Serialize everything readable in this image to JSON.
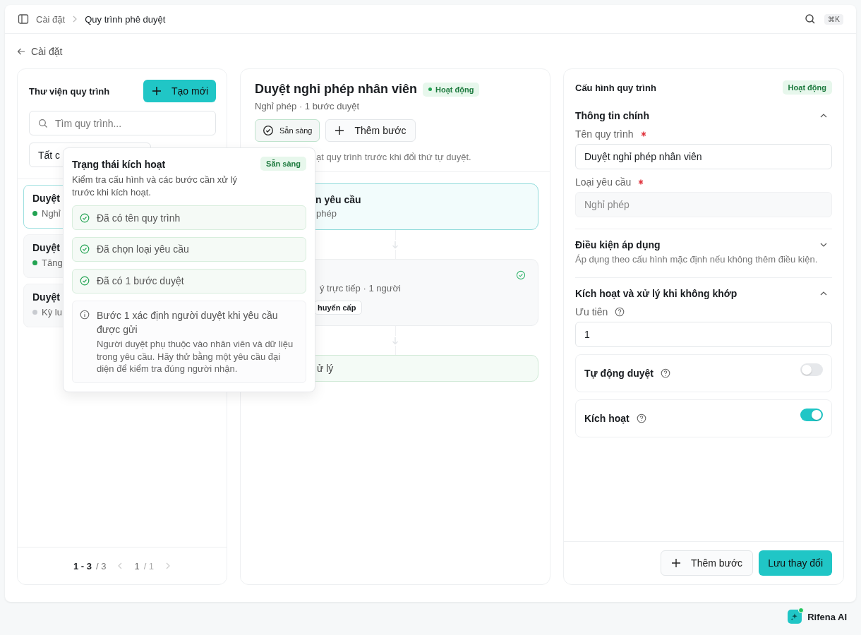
{
  "breadcrumb": {
    "items": [
      {
        "label": "Cài đặt",
        "current": false
      },
      {
        "label": "Quy trình phê duyệt",
        "current": true
      }
    ],
    "shortcut": "⌘K"
  },
  "back_link": "Cài đặt",
  "library": {
    "title": "Thư viện quy trình",
    "create_button": "Tạo mới",
    "search_placeholder": "Tìm quy trình...",
    "filter": "Tất c",
    "items": [
      {
        "title": "Duyệt",
        "subtitle": "Nghỉ",
        "color": "#22a352",
        "selected": true
      },
      {
        "title": "Duyệt",
        "subtitle": "Tăng",
        "color": "#22a352",
        "selected": false
      },
      {
        "title": "Duyệt",
        "subtitle": "Kỳ lu",
        "color": "#c8cbd0",
        "selected": false
      }
    ],
    "pagination": {
      "range": "1 - 3",
      "total": "/ 3",
      "page": "1",
      "pages": "/ 1"
    }
  },
  "workflow": {
    "title": "Duyệt nghỉ phép nhân viên",
    "status": "Hoạt động",
    "subtitle": "Nghỉ phép · 1 bước duyệt",
    "ready_button": "Sẵn sàng",
    "add_step_button": "Thêm bước",
    "hint": "ạt quy trình trước khi đổi thứ tự duyệt.",
    "steps": [
      {
        "kind": "trigger",
        "title": "n yêu cầu",
        "subtitle": "phép",
        "done": false
      },
      {
        "kind": "approval",
        "subtitle": "ý trực tiếp · 1 người",
        "tag": "huyển cấp",
        "done": true
      },
      {
        "kind": "end",
        "title": "ử lý",
        "done": false
      }
    ]
  },
  "popover": {
    "title": "Trạng thái kích hoạt",
    "badge": "Sẵn sàng",
    "description": "Kiểm tra cấu hình và các bước cần xử lý trước khi kích hoạt.",
    "checks": [
      {
        "label": "Đã có tên quy trình",
        "passed": true
      },
      {
        "label": "Đã chọn loại yêu cầu",
        "passed": true
      },
      {
        "label": "Đã có 1 bước duyệt",
        "passed": true
      }
    ],
    "notice": {
      "title": "Bước 1 xác định người duyệt khi yêu cầu được gửi",
      "body": "Người duyệt phụ thuộc vào nhân viên và dữ liệu trong yêu cầu. Hãy thử bằng một yêu cầu đại diện để kiểm tra đúng người nhận."
    }
  },
  "config": {
    "title": "Cấu hình quy trình",
    "status": "Hoạt động",
    "sections": [
      {
        "title": "Thông tin chính",
        "expanded": true,
        "fields": [
          {
            "label": "Tên quy trình",
            "required": true,
            "help": false,
            "value": "Duyệt nghỉ phép nhân viên",
            "disabled": false
          },
          {
            "label": "Loại yêu cầu",
            "required": true,
            "help": false,
            "value": "Nghỉ phép",
            "disabled": true
          }
        ]
      },
      {
        "title": "Điều kiện áp dụng",
        "expanded": false,
        "description": "Áp dụng theo cấu hình mặc định nếu không thêm điều kiện."
      },
      {
        "title": "Kích hoạt và xử lý khi không khớp",
        "expanded": true,
        "fields": [
          {
            "label": "Ưu tiên",
            "required": false,
            "help": true,
            "value": "1",
            "disabled": false
          }
        ],
        "toggles": [
          {
            "label": "Tự động duyệt",
            "on": false
          },
          {
            "label": "Kích hoạt",
            "on": true
          }
        ]
      }
    ],
    "add_step_button": "Thêm bước",
    "save_button": "Lưu thay đổi"
  },
  "assistant": {
    "label": "Rifena AI"
  }
}
